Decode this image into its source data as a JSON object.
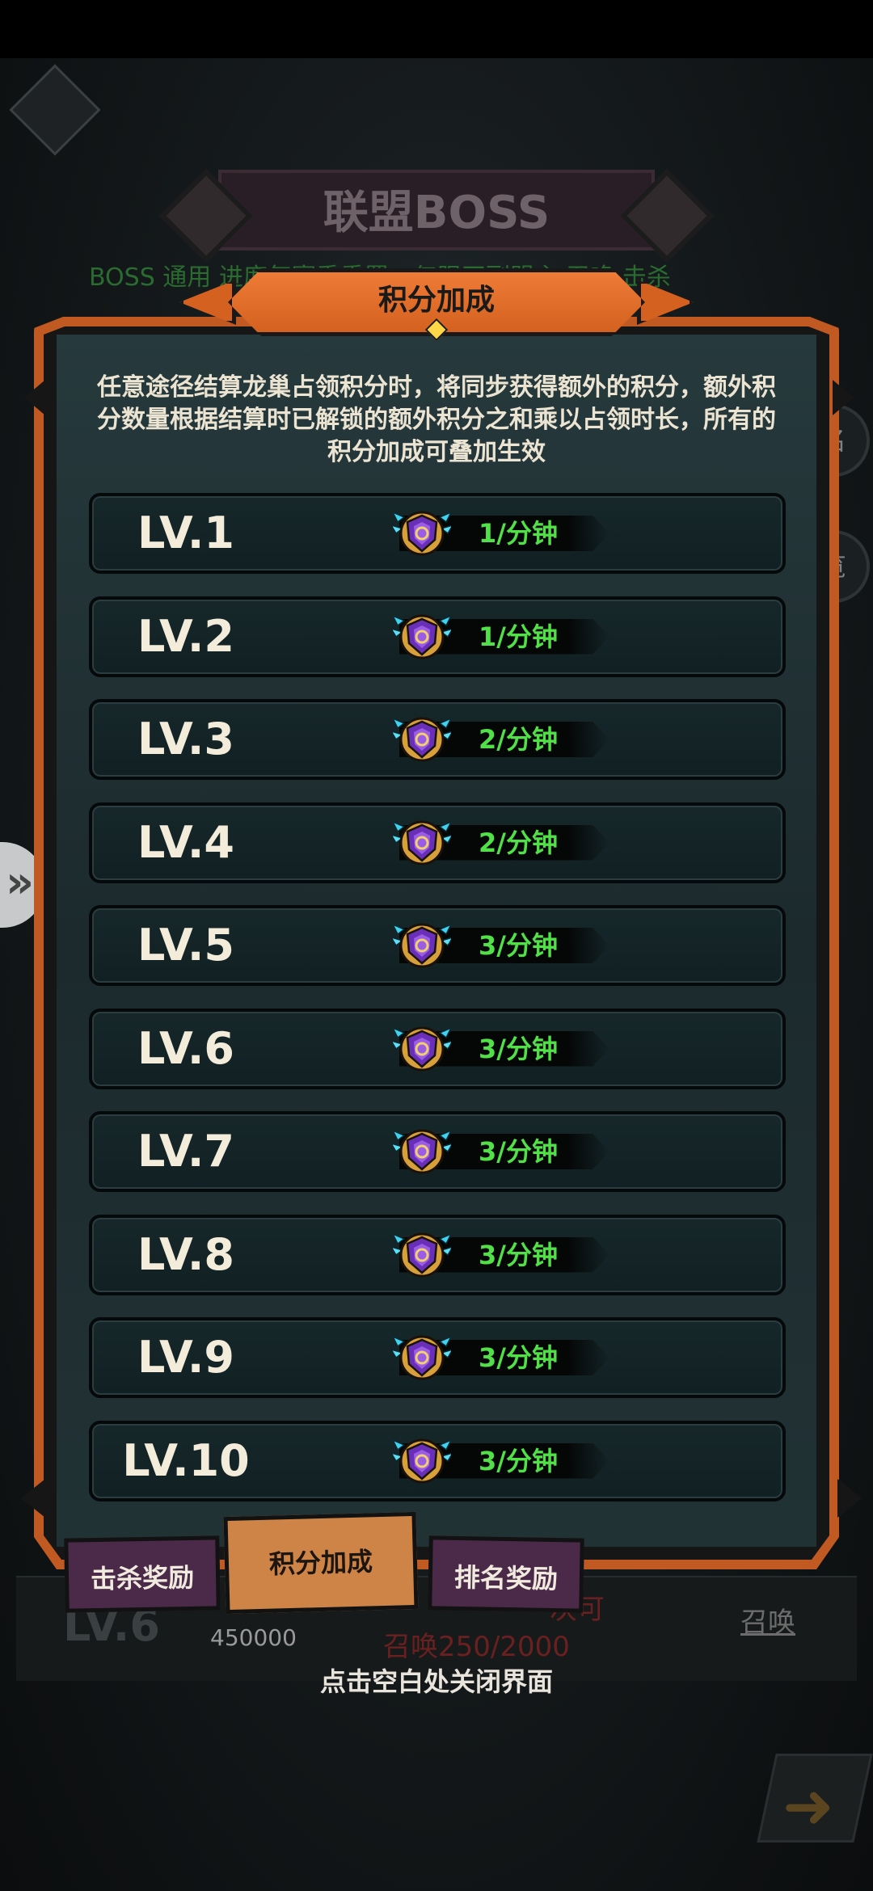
{
  "background": {
    "boss_title": "联盟BOSS",
    "boss_desc": "BOSS 通用 进度每赛季重置，仅限正副盟主 召唤 击杀",
    "side_right_1": "名",
    "side_right_2": "览",
    "level_label": "LV.6",
    "value_number": "450000",
    "summon_times": "次可",
    "summon_count": "召唤250/2000",
    "summon_button": "召唤"
  },
  "panel": {
    "title": "积分加成",
    "description": "任意途径结算龙巢占领积分时，将同步获得额外的积分，额外积分数量根据结算时已解锁的额外积分之和乘以占领时长，所有的积分加成可叠加生效",
    "rows": [
      {
        "level": "LV.1",
        "rate": "1/分钟"
      },
      {
        "level": "LV.2",
        "rate": "1/分钟"
      },
      {
        "level": "LV.3",
        "rate": "2/分钟"
      },
      {
        "level": "LV.4",
        "rate": "2/分钟"
      },
      {
        "level": "LV.5",
        "rate": "3/分钟"
      },
      {
        "level": "LV.6",
        "rate": "3/分钟"
      },
      {
        "level": "LV.7",
        "rate": "3/分钟"
      },
      {
        "level": "LV.8",
        "rate": "3/分钟"
      },
      {
        "level": "LV.9",
        "rate": "3/分钟"
      },
      {
        "level": "LV.10",
        "rate": "3/分钟"
      }
    ]
  },
  "tabs": {
    "kill_reward": "击杀奖励",
    "points_bonus": "积分加成",
    "rank_reward": "排名奖励"
  },
  "close_hint": "点击空白处关闭界面",
  "colors": {
    "accent_orange": "#d4611f",
    "rate_green": "#52e048",
    "panel_teal": "#1c2a2d",
    "tab_purple": "#4a2a48"
  },
  "icons": {
    "row_badge": "purple-shield-badge-icon",
    "left_nav": "double-chevron-right-icon",
    "corner": "arrow-icon"
  }
}
